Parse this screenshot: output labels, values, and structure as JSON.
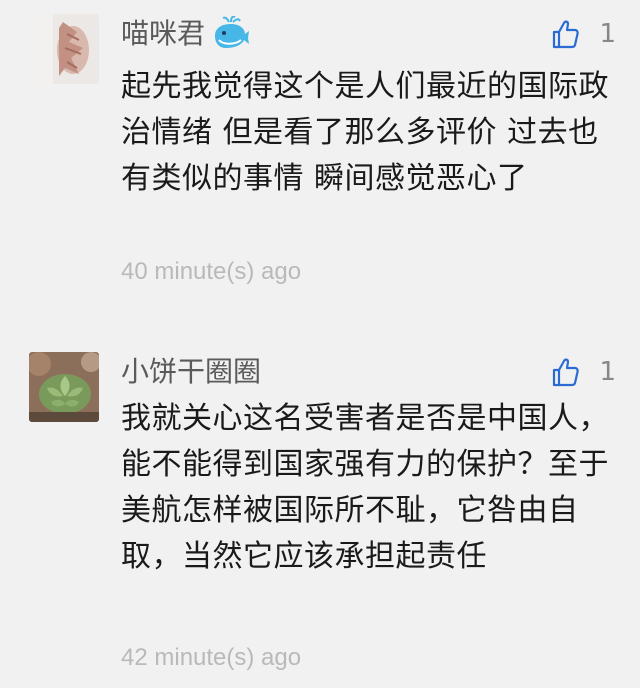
{
  "comments": [
    {
      "username": "喵咪君",
      "likes": "1",
      "text": "起先我觉得这个是人们最近的国际政治情绪  但是看了那么多评价  过去也有类似的事情  瞬间感觉恶心了",
      "time": "40 minute(s) ago",
      "badge_icon": "whale-icon"
    },
    {
      "username": "小饼干圈圈",
      "likes": "1",
      "text": "我就关心这名受害者是否是中国人，能不能得到国家强有力的保护？至于美航怎样被国际所不耻，它咎由自取，当然它应该承担起责任",
      "time": "42 minute(s) ago"
    }
  ],
  "colors": {
    "background": "#f1f1f1",
    "like_icon": "#2a6bd4",
    "badge": "#46b7e6"
  }
}
